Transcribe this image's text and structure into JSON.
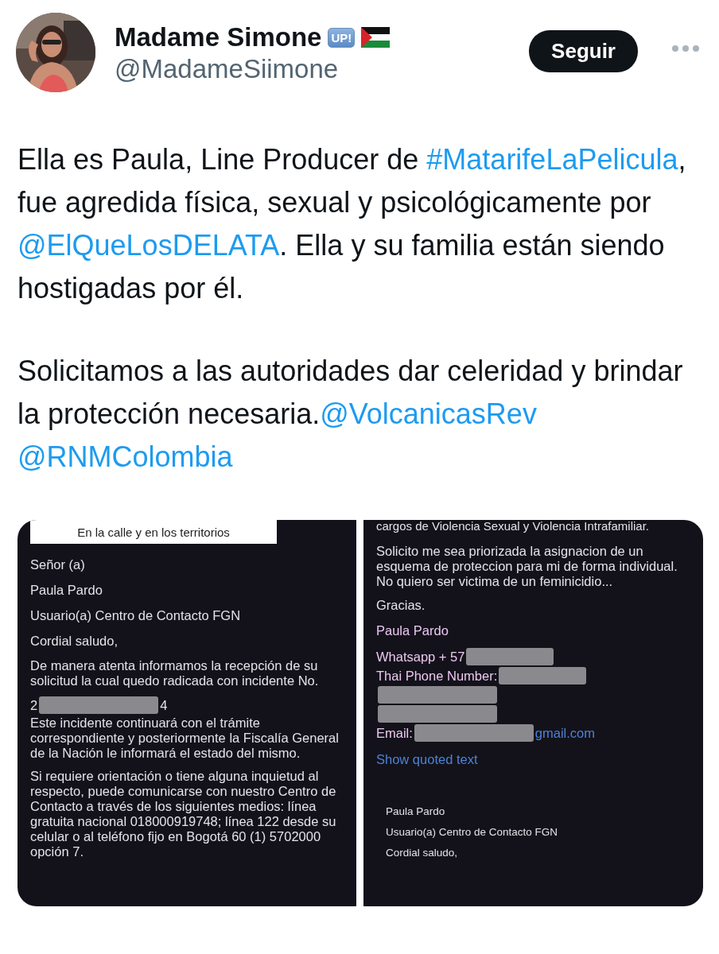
{
  "author": {
    "name": "Madame Simone",
    "badge": "UP!",
    "handle": "@MadameSiimone"
  },
  "follow_button": "Seguir",
  "tweet": {
    "paragraphs": [
      [
        {
          "kind": "text",
          "text": "Ella es Paula, Line Producer de "
        },
        {
          "kind": "link",
          "text": "#MatarifeLaPelicula"
        },
        {
          "kind": "text",
          "text": ", fue agredida física, sexual y psicológicamente por "
        },
        {
          "kind": "link",
          "text": "@ElQueLosDELATA"
        },
        {
          "kind": "text",
          "text": ". Ella y su familia están siendo hostigadas por él."
        }
      ],
      [
        {
          "kind": "text",
          "text": "Solicitamos a las autoridades dar celeridad y brindar la protección necesaria."
        },
        {
          "kind": "link",
          "text": "@VolcanicasRev"
        },
        {
          "kind": "break"
        },
        {
          "kind": "link",
          "text": "@RNMColombia"
        }
      ]
    ]
  },
  "images": [
    {
      "blocks": [
        {
          "kind": "banner",
          "text": "En la calle y en los territorios"
        },
        {
          "kind": "line",
          "text": "Señor (a)"
        },
        {
          "kind": "line",
          "text": "Paula Pardo"
        },
        {
          "kind": "line",
          "text": "Usuario(a) Centro de Contacto FGN"
        },
        {
          "kind": "line",
          "text": "Cordial saludo,"
        },
        {
          "kind": "para",
          "text": "De manera atenta informamos la recepción de su solicitud la cual quedo radicada con incidente No."
        },
        {
          "kind": "redacted",
          "before": "2",
          "after": "4"
        },
        {
          "kind": "para",
          "text": "Este incidente continuará con el trámite correspondiente y posteriormente la Fiscalía General de la Nación le informará el estado del mismo."
        },
        {
          "kind": "para",
          "text": "Si requiere orientación o tiene alguna inquietud al respecto, puede comunicarse con nuestro Centro de Contacto a través de los siguientes medios: línea gratuita nacional 018000919748; línea 122 desde su celular o al teléfono fijo en Bogotá 60 (1) 5702000 opción 7."
        }
      ]
    },
    {
      "blocks": [
        {
          "kind": "cut",
          "text": "cargos de Violencia Sexual y Violencia Intrafamiliar."
        },
        {
          "kind": "para",
          "text": "Solicito me sea priorizada la asignacion de un esquema de proteccion para mi de forma individual. No quiero ser victima de un feminicidio..."
        },
        {
          "kind": "line",
          "text": "Gracias."
        },
        {
          "kind": "accent",
          "text": "Paula Pardo"
        },
        {
          "kind": "contact",
          "before": "Whatsapp + 57"
        },
        {
          "kind": "contact",
          "before": "Thai Phone Number:"
        },
        {
          "kind": "blackout"
        },
        {
          "kind": "blackout"
        },
        {
          "kind": "contact",
          "before": "Email:",
          "after": "gmail.com"
        },
        {
          "kind": "link",
          "text": "Show quoted text"
        },
        {
          "kind": "quoted",
          "text": "Paula Pardo"
        },
        {
          "kind": "quoted",
          "text": "Usuario(a) Centro de Contacto FGN"
        },
        {
          "kind": "quoted",
          "text": "Cordial saludo,"
        }
      ]
    }
  ]
}
